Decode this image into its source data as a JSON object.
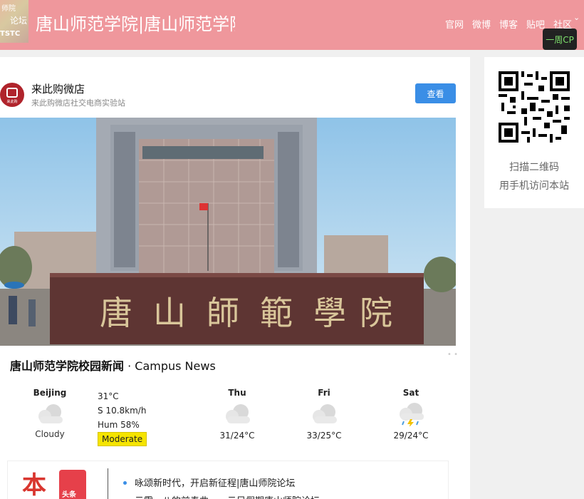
{
  "header": {
    "logo_lines": [
      "师院",
      "论坛",
      "TSTC"
    ],
    "site_title": "唐山师范学院|唐山师范学院",
    "nav": [
      "官网",
      "微博",
      "博客",
      "贴吧",
      "社区"
    ],
    "week_cp": "一周CP"
  },
  "shop": {
    "name": "来此购微店",
    "subtitle": "来此购微店社交电商实验站",
    "view_button": "查看",
    "avatar_text": "来此购"
  },
  "news": {
    "title_cn": "唐山师范学院校园新闻",
    "title_en": " · Campus News",
    "badge_big": "本",
    "badge_small": "头条",
    "items": [
      "咏颂新时代，开启新征程|唐山师院论坛",
      "云雾，八的前奏曲，，，云目假期唐山师院论坛"
    ]
  },
  "weather": {
    "city": "Beijing",
    "condition": "Cloudy",
    "temp": "31°C",
    "wind": "S 10.8km/h",
    "humidity": "Hum 58%",
    "aqi": "Moderate",
    "forecast": [
      {
        "day": "Thu",
        "temp": "31/24°C",
        "icon": "cloudy-icon"
      },
      {
        "day": "Fri",
        "temp": "33/25°C",
        "icon": "cloudy-icon"
      },
      {
        "day": "Sat",
        "temp": "29/24°C",
        "icon": "thunderstorm-icon"
      }
    ]
  },
  "qr": {
    "line1": "扫描二维码",
    "line2": "用手机访问本站"
  },
  "colors": {
    "header_bg": "#ef979c",
    "button_blue": "#3a8ee6",
    "aqi_yellow": "#f5e400",
    "cp_green": "#7ee06c"
  }
}
